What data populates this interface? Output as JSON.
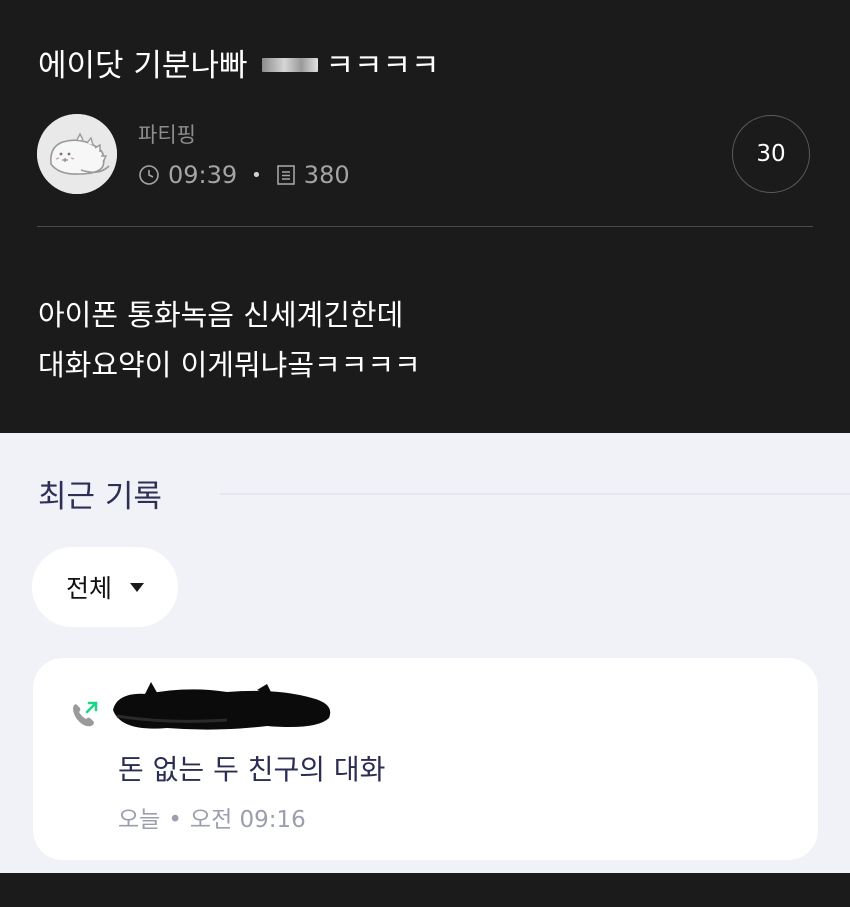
{
  "post": {
    "title": "에이닷 기분나빠",
    "title_suffix": "ㅋㅋㅋㅋ",
    "author": "파티핑",
    "time": "09:39",
    "views": "380",
    "comments": "30",
    "body_lines": [
      "아이폰 통화녹음 신세계긴한데",
      "대화요약이 이게뭐냐곸ㅋㅋㅋㅋ"
    ],
    "icons": {
      "avatar": "dinosaur-avatar-icon",
      "time": "clock-icon",
      "views": "document-icon"
    }
  },
  "app": {
    "section_title": "최근 기록",
    "filter": {
      "label": "전체",
      "icon": "caret-down-icon"
    },
    "records": [
      {
        "title": "돈 없는 두 친구의 대화",
        "day": "오늘",
        "separator": "•",
        "time": "오전 09:16",
        "icon": "outgoing-call-icon"
      }
    ],
    "colors": {
      "accent_text": "#2b2d55",
      "call_green": "#1fd38a",
      "background": "#f1f2f7"
    }
  }
}
